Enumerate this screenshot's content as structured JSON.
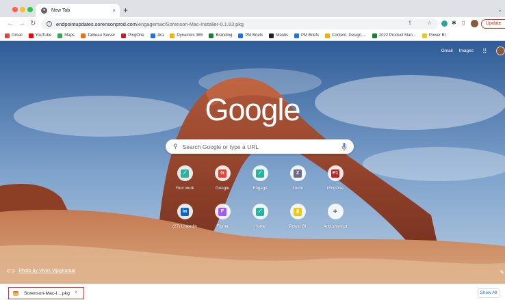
{
  "tab": {
    "title": "New Tab",
    "close": "×",
    "new_tab": "+"
  },
  "toolbar": {
    "back": "←",
    "forward": "→",
    "reload": "C",
    "url_host": "endpointupdates.sorensonprod.com",
    "url_path": "/engagemac/Sorenson-Mac-Installer-0.1.63.pkg",
    "update_label": "Update"
  },
  "bookmarks": [
    {
      "label": "Gmail",
      "color": "#ea4335"
    },
    {
      "label": "YouTube",
      "color": "#ff0000"
    },
    {
      "label": "Maps",
      "color": "#34a853"
    },
    {
      "label": "Tableau Server",
      "color": "#e8710a"
    },
    {
      "label": "PingOne",
      "color": "#c5221f"
    },
    {
      "label": "Jira",
      "color": "#1a73e8"
    },
    {
      "label": "Dynamics 365",
      "color": "#f4b400"
    },
    {
      "label": "Branding",
      "color": "#188038"
    },
    {
      "label": "PM Briefs",
      "color": "#1a73e8"
    },
    {
      "label": "Mantis",
      "color": "#202124"
    },
    {
      "label": "PM Briefs",
      "color": "#1a73e8"
    },
    {
      "label": "Content, Design,...",
      "color": "#f9ab00"
    },
    {
      "label": "2022 Product Man...",
      "color": "#188038"
    },
    {
      "label": "Power BI",
      "color": "#f2c811"
    }
  ],
  "ntp": {
    "top_links": [
      "Gmail",
      "Images"
    ],
    "logo": "Google",
    "search_placeholder": "Search Google or type a URL",
    "shortcuts_row1": [
      {
        "label": "Your work",
        "glyph": "⟋",
        "color": "#2bb3a0"
      },
      {
        "label": "Google",
        "glyph": "G",
        "color": "#ea4335"
      },
      {
        "label": "Engage",
        "glyph": "⟋",
        "color": "#2bb3a0"
      },
      {
        "label": "Zoom",
        "glyph": "Z",
        "color": "#6f6a85"
      },
      {
        "label": "PingOne",
        "glyph": "P1",
        "color": "#c5221f"
      }
    ],
    "shortcuts_row2": [
      {
        "label": "(27) Linkedin",
        "glyph": "in",
        "color": "#0a66c2"
      },
      {
        "label": "Figma",
        "glyph": "F",
        "color": "#a259ff"
      },
      {
        "label": "Home",
        "glyph": "⟋",
        "color": "#2bb3a0"
      },
      {
        "label": "Power BI",
        "glyph": "▮",
        "color": "#f2c811"
      },
      {
        "label": "Add shortcut",
        "glyph": "+",
        "color": "#5f6368"
      }
    ],
    "photo_credit": "Photo by Vivek Vijaykumar"
  },
  "download": {
    "filename": "Sorenson-Mac-I....pkg",
    "caret": "^",
    "show_all": "Show All"
  }
}
